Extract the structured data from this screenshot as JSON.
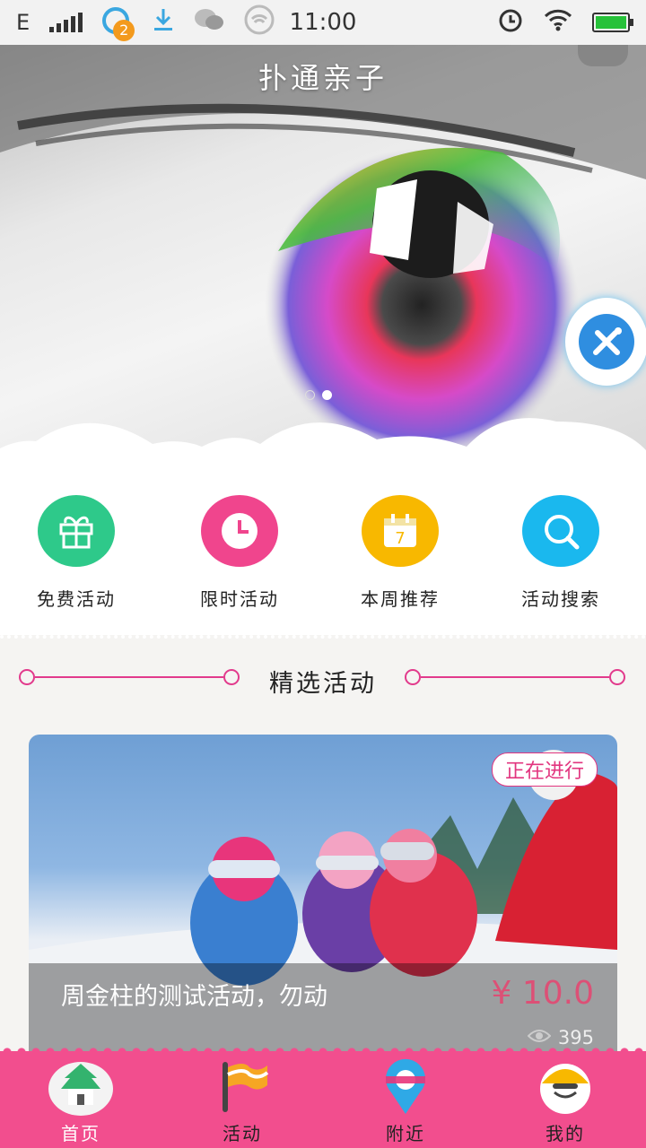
{
  "status_bar": {
    "network": "E",
    "notification_count": "2",
    "time": "11:00"
  },
  "hero": {
    "app_title": "扑通亲子",
    "carousel_pages": 2,
    "active_page": 2
  },
  "menu": {
    "items": [
      {
        "label": "免费活动",
        "icon": "gift-icon",
        "color": "#2ec98a"
      },
      {
        "label": "限时活动",
        "icon": "clock-icon",
        "color": "#f0458d"
      },
      {
        "label": "本周推荐",
        "icon": "calendar-icon",
        "color": "#f8b800"
      },
      {
        "label": "活动搜索",
        "icon": "search-icon",
        "color": "#1ab8ee"
      }
    ]
  },
  "featured": {
    "section_title": "精选活动",
    "card": {
      "status": "正在进行",
      "title": "周金柱的测试活动，勿动",
      "price": "¥ 10.0",
      "views": "395"
    }
  },
  "tabbar": {
    "tabs": [
      {
        "label": "首页",
        "icon": "home-icon",
        "active": true
      },
      {
        "label": "活动",
        "icon": "flag-icon",
        "active": false
      },
      {
        "label": "附近",
        "icon": "location-icon",
        "active": false
      },
      {
        "label": "我的",
        "icon": "profile-icon",
        "active": false
      }
    ]
  },
  "colors": {
    "accent": "#f24e8e",
    "price": "#e8436f"
  }
}
